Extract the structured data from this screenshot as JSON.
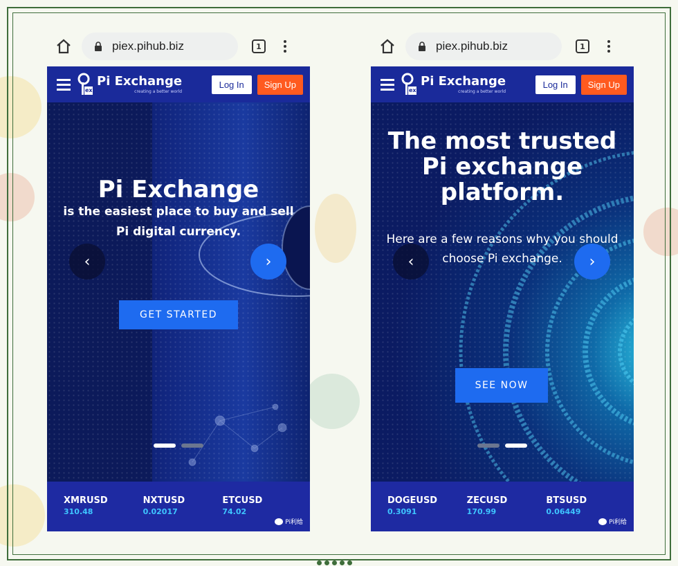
{
  "phones": [
    {
      "url": "piex.pihub.biz",
      "tab_count": "1",
      "brand": "Pi Exchange",
      "tagline": "creating a better world",
      "logo_badge": "ex",
      "login": "Log In",
      "signup": "Sign Up",
      "hero_title": "Pi Exchange",
      "hero_sub": "is the easiest place to buy and sell Pi digital currency.",
      "cta": "GET STARTED",
      "prev_arrow": "‹",
      "next_arrow": "›",
      "active_slide": 1,
      "tickers": [
        {
          "symbol": "XMRUSD",
          "value": "310.48"
        },
        {
          "symbol": "NXTUSD",
          "value": "0.02017"
        },
        {
          "symbol": "ETCUSD",
          "value": "74.02"
        }
      ],
      "watermark": "Pi利给"
    },
    {
      "url": "piex.pihub.biz",
      "tab_count": "1",
      "brand": "Pi Exchange",
      "tagline": "creating a better world",
      "logo_badge": "ex",
      "login": "Log In",
      "signup": "Sign Up",
      "hero_title": "The most trusted Pi exchange platform.",
      "hero_sub": "Here are a few reasons why you should choose Pi exchange.",
      "cta": "SEE NOW",
      "prev_arrow": "‹",
      "next_arrow": "›",
      "active_slide": 2,
      "tickers": [
        {
          "symbol": "DOGEUSD",
          "value": "0.3091"
        },
        {
          "symbol": "ZECUSD",
          "value": "170.99"
        },
        {
          "symbol": "BTSUSD",
          "value": "0.06449"
        }
      ],
      "watermark": "Pi利给"
    }
  ],
  "colors": {
    "nav": "#1a2a9a",
    "signup": "#ff5a1f",
    "cta": "#1e6bf0",
    "ticker_value": "#3ec5ff",
    "frame": "#3e6d3a"
  }
}
